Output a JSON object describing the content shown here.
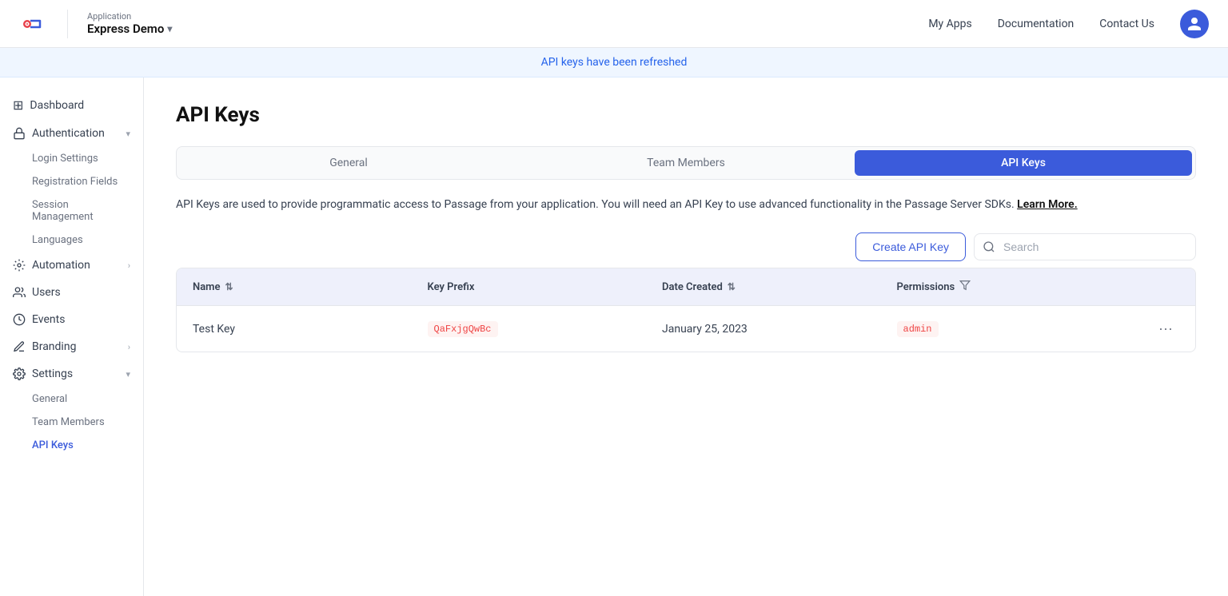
{
  "app": {
    "label": "Application",
    "name": "Express Demo"
  },
  "header": {
    "nav": [
      {
        "id": "my-apps",
        "label": "My Apps"
      },
      {
        "id": "documentation",
        "label": "Documentation"
      },
      {
        "id": "contact-us",
        "label": "Contact Us"
      }
    ]
  },
  "notification": {
    "message": "API keys have been refreshed"
  },
  "sidebar": {
    "items": [
      {
        "id": "dashboard",
        "label": "Dashboard",
        "icon": "⊞",
        "hasChildren": false
      },
      {
        "id": "authentication",
        "label": "Authentication",
        "icon": "🔒",
        "hasChildren": true,
        "expanded": true
      },
      {
        "id": "automation",
        "label": "Automation",
        "icon": "⚙",
        "hasChildren": true
      },
      {
        "id": "users",
        "label": "Users",
        "icon": "👥",
        "hasChildren": false
      },
      {
        "id": "events",
        "label": "Events",
        "icon": "◷",
        "hasChildren": false
      },
      {
        "id": "branding",
        "label": "Branding",
        "icon": "✏",
        "hasChildren": true
      },
      {
        "id": "settings",
        "label": "Settings",
        "icon": "⚙",
        "hasChildren": true,
        "expanded": true
      }
    ],
    "authSubItems": [
      {
        "id": "login-settings",
        "label": "Login Settings"
      },
      {
        "id": "registration-fields",
        "label": "Registration Fields"
      },
      {
        "id": "session-management",
        "label": "Session Management"
      },
      {
        "id": "languages",
        "label": "Languages"
      }
    ],
    "settingsSubItems": [
      {
        "id": "general",
        "label": "General"
      },
      {
        "id": "team-members",
        "label": "Team Members"
      },
      {
        "id": "api-keys",
        "label": "API Keys"
      }
    ]
  },
  "page": {
    "title": "API Keys"
  },
  "tabs": [
    {
      "id": "general",
      "label": "General"
    },
    {
      "id": "team-members",
      "label": "Team Members"
    },
    {
      "id": "api-keys",
      "label": "API Keys"
    }
  ],
  "description": {
    "text": "API Keys are used to provide programmatic access to Passage from your application. You will need an API Key to use advanced functionality in the Passage Server SDKs.",
    "linkText": "Learn More."
  },
  "toolbar": {
    "create_button_label": "Create API Key",
    "search_placeholder": "Search"
  },
  "table": {
    "columns": [
      {
        "id": "name",
        "label": "Name",
        "sortable": true
      },
      {
        "id": "key-prefix",
        "label": "Key Prefix",
        "sortable": false
      },
      {
        "id": "date-created",
        "label": "Date Created",
        "sortable": true
      },
      {
        "id": "permissions",
        "label": "Permissions",
        "filterable": true
      }
    ],
    "rows": [
      {
        "name": "Test Key",
        "keyPrefix": "QaFxjgQwBc",
        "dateCreated": "January 25, 2023",
        "permissions": "admin"
      }
    ]
  }
}
